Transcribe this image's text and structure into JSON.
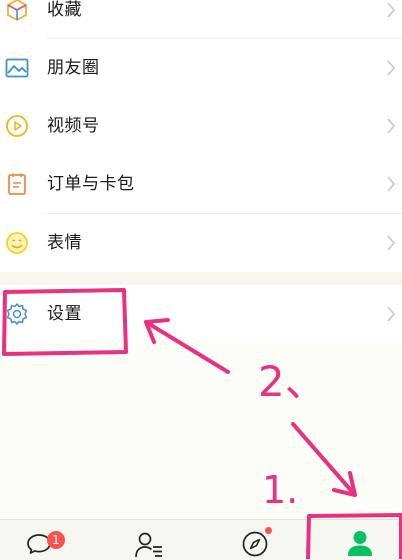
{
  "menu": {
    "favorites_label": "收藏",
    "moments_label": "朋友圈",
    "channels_label": "视频号",
    "orders_label": "订单与卡包",
    "stickers_label": "表情",
    "settings_label": "设置"
  },
  "tabbar": {
    "chats_badge": "1"
  },
  "annotations": {
    "step_one": "1.",
    "step_two": "2、"
  },
  "colors": {
    "annotation": "#e8327f",
    "me_active": "#07c160",
    "badge": "#fa5151"
  }
}
